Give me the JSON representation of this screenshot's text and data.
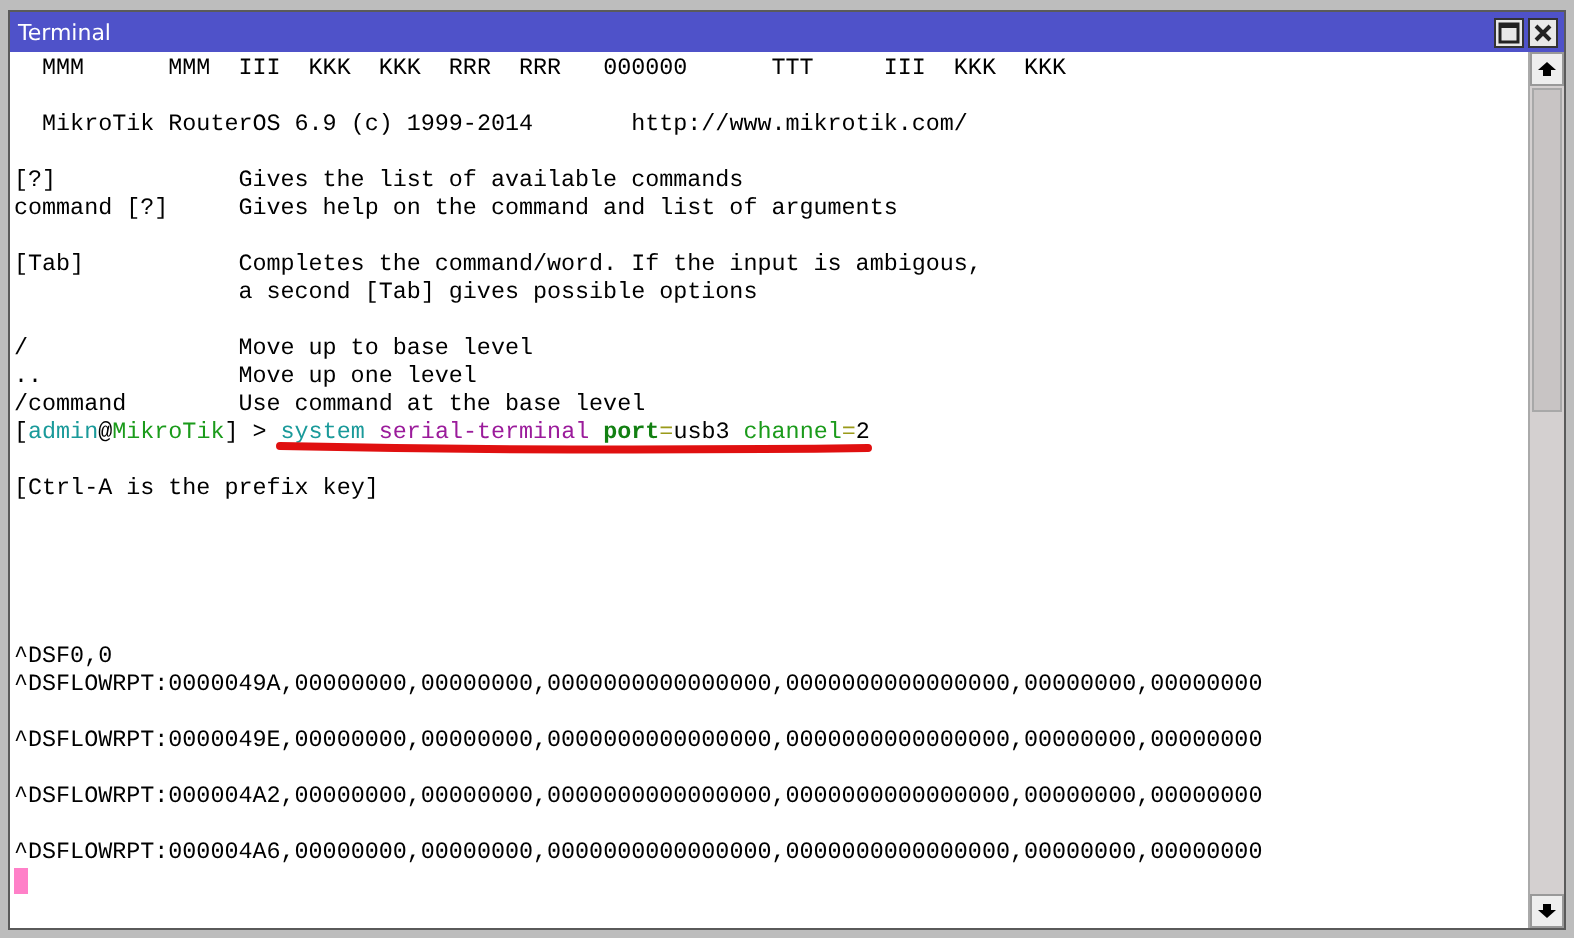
{
  "window": {
    "title": "Terminal"
  },
  "lines": [
    {
      "kind": "text",
      "text": "  MMM      MMM  III  KKK  KKK  RRR  RRR   000000      TTT     III  KKK  KKK"
    },
    {
      "kind": "blank"
    },
    {
      "kind": "text",
      "text": "  MikroTik RouterOS 6.9 (c) 1999-2014       http://www.mikrotik.com/"
    },
    {
      "kind": "blank"
    },
    {
      "kind": "help",
      "key": "[?]",
      "desc": "Gives the list of available commands"
    },
    {
      "kind": "help",
      "key": "command [?]",
      "desc": "Gives help on the command and list of arguments"
    },
    {
      "kind": "blank"
    },
    {
      "kind": "help",
      "key": "[Tab]",
      "desc": "Completes the command/word. If the input is ambigous,"
    },
    {
      "kind": "help",
      "desc": "a second [Tab] gives possible options"
    },
    {
      "kind": "blank"
    },
    {
      "kind": "help",
      "key": "/",
      "desc": "Move up to base level"
    },
    {
      "kind": "help",
      "key": "..",
      "desc": "Move up one level"
    },
    {
      "kind": "help",
      "key": "/command",
      "desc": "Use command at the base level"
    },
    {
      "kind": "prompt",
      "underlined": true,
      "segments": [
        {
          "text": "[",
          "color": "#000000"
        },
        {
          "text": "admin",
          "color": "#1a9a9a"
        },
        {
          "text": "@",
          "color": "#000000"
        },
        {
          "text": "MikroTik",
          "color": "#1b9b1b"
        },
        {
          "text": "] > ",
          "color": "#000000"
        },
        {
          "text": "system ",
          "color": "#1a9a9a"
        },
        {
          "text": "serial-terminal ",
          "color": "#9b1b9b"
        },
        {
          "text": "port",
          "color": "#128012",
          "bold": true
        },
        {
          "text": "=",
          "color": "#9a9a1a"
        },
        {
          "text": "usb3 ",
          "color": "#000000"
        },
        {
          "text": "channel",
          "color": "#1b9b1b"
        },
        {
          "text": "=",
          "color": "#9a9a1a"
        },
        {
          "text": "2",
          "color": "#000000"
        }
      ]
    },
    {
      "kind": "blank"
    },
    {
      "kind": "text",
      "text": "[Ctrl-A is the prefix key]"
    },
    {
      "kind": "blank"
    },
    {
      "kind": "blank"
    },
    {
      "kind": "blank"
    },
    {
      "kind": "blank"
    },
    {
      "kind": "blank"
    },
    {
      "kind": "text",
      "text": "^DSF0,0"
    },
    {
      "kind": "text",
      "text": "^DSFLOWRPT:0000049A,00000000,00000000,0000000000000000,0000000000000000,00000000,00000000"
    },
    {
      "kind": "blank"
    },
    {
      "kind": "text",
      "text": "^DSFLOWRPT:0000049E,00000000,00000000,0000000000000000,0000000000000000,00000000,00000000"
    },
    {
      "kind": "blank"
    },
    {
      "kind": "text",
      "text": "^DSFLOWRPT:000004A2,00000000,00000000,0000000000000000,0000000000000000,00000000,00000000"
    },
    {
      "kind": "blank"
    },
    {
      "kind": "text",
      "text": "^DSFLOWRPT:000004A6,00000000,00000000,0000000000000000,0000000000000000,00000000,00000000"
    },
    {
      "kind": "cursor"
    }
  ]
}
